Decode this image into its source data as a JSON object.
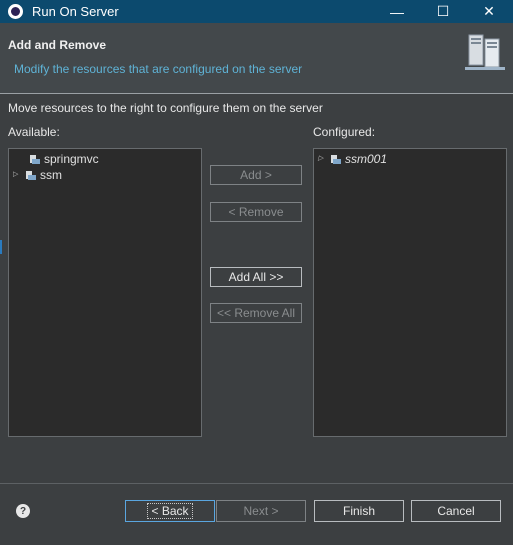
{
  "window": {
    "title": "Run On Server",
    "minimize": "—",
    "maximize": "☐",
    "close": "✕"
  },
  "header": {
    "title": "Add and Remove",
    "description": "Modify the resources that are configured on the server"
  },
  "instruction": "Move resources to the right to configure them on the server",
  "available": {
    "label": "Available:",
    "items": [
      {
        "label": "springmvc",
        "expandable": false
      },
      {
        "label": "ssm",
        "expandable": true
      }
    ]
  },
  "configured": {
    "label": "Configured:",
    "items": [
      {
        "label": "ssm001",
        "expandable": true
      }
    ]
  },
  "buttons": {
    "add": "Add >",
    "remove": "< Remove",
    "add_all": "Add All >>",
    "remove_all": "<< Remove All"
  },
  "footer": {
    "help": "?",
    "back": "< Back",
    "next": "Next >",
    "finish": "Finish",
    "cancel": "Cancel"
  },
  "colors": {
    "titlebar": "#0c4a6e",
    "dialog_bg": "#3c3f41",
    "list_bg": "#2b2b2b",
    "link_blue": "#5fb3d6"
  }
}
